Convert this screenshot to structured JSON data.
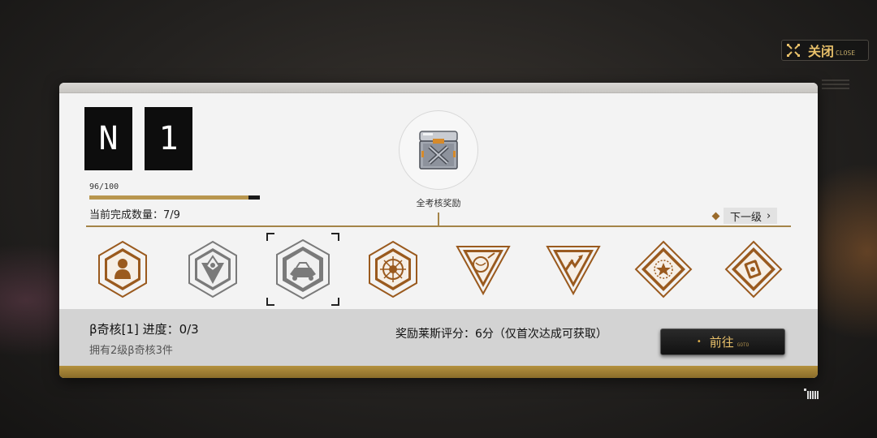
{
  "close": {
    "label": "关闭",
    "sub": "CLOSE",
    "icon": "close-icon"
  },
  "rank": {
    "letter": "N",
    "number": "1"
  },
  "progress": {
    "score_text": "96/100",
    "value": 96,
    "max": 100
  },
  "completion_text": "当前完成数量：7/9",
  "reward": {
    "label": "全考核奖励",
    "icon": "chest-icon"
  },
  "next_level": {
    "label": "下一级"
  },
  "badges": [
    {
      "name": "person-badge-icon",
      "color": "#9a5a1e",
      "selected": false
    },
    {
      "name": "emblem-badge-icon",
      "color": "#7a7a7a",
      "selected": false
    },
    {
      "name": "vehicle-badge-icon",
      "color": "#7a7a7a",
      "selected": true
    },
    {
      "name": "compass-badge-icon",
      "color": "#9a5a1e",
      "selected": false
    },
    {
      "name": "orb-badge-icon",
      "color": "#9a5a1e",
      "selected": false
    },
    {
      "name": "arrows-badge-icon",
      "color": "#9a5a1e",
      "selected": false
    },
    {
      "name": "star-badge-icon",
      "color": "#9a5a1e",
      "selected": false
    },
    {
      "name": "card-badge-icon",
      "color": "#9a5a1e",
      "selected": false
    }
  ],
  "task": {
    "title": "β奇核[1] 进度：0/3",
    "subtitle": "拥有2级β奇核3件",
    "reward_desc": "奖励莱斯评分：6分（仅首次达成可获取）"
  },
  "goto": {
    "label": "前往",
    "sub": "GOTO"
  },
  "colors": {
    "accent": "#b8964e",
    "bronze": "#9a5a1e",
    "gray": "#7a7a7a",
    "gold_text": "#e8c06a"
  }
}
